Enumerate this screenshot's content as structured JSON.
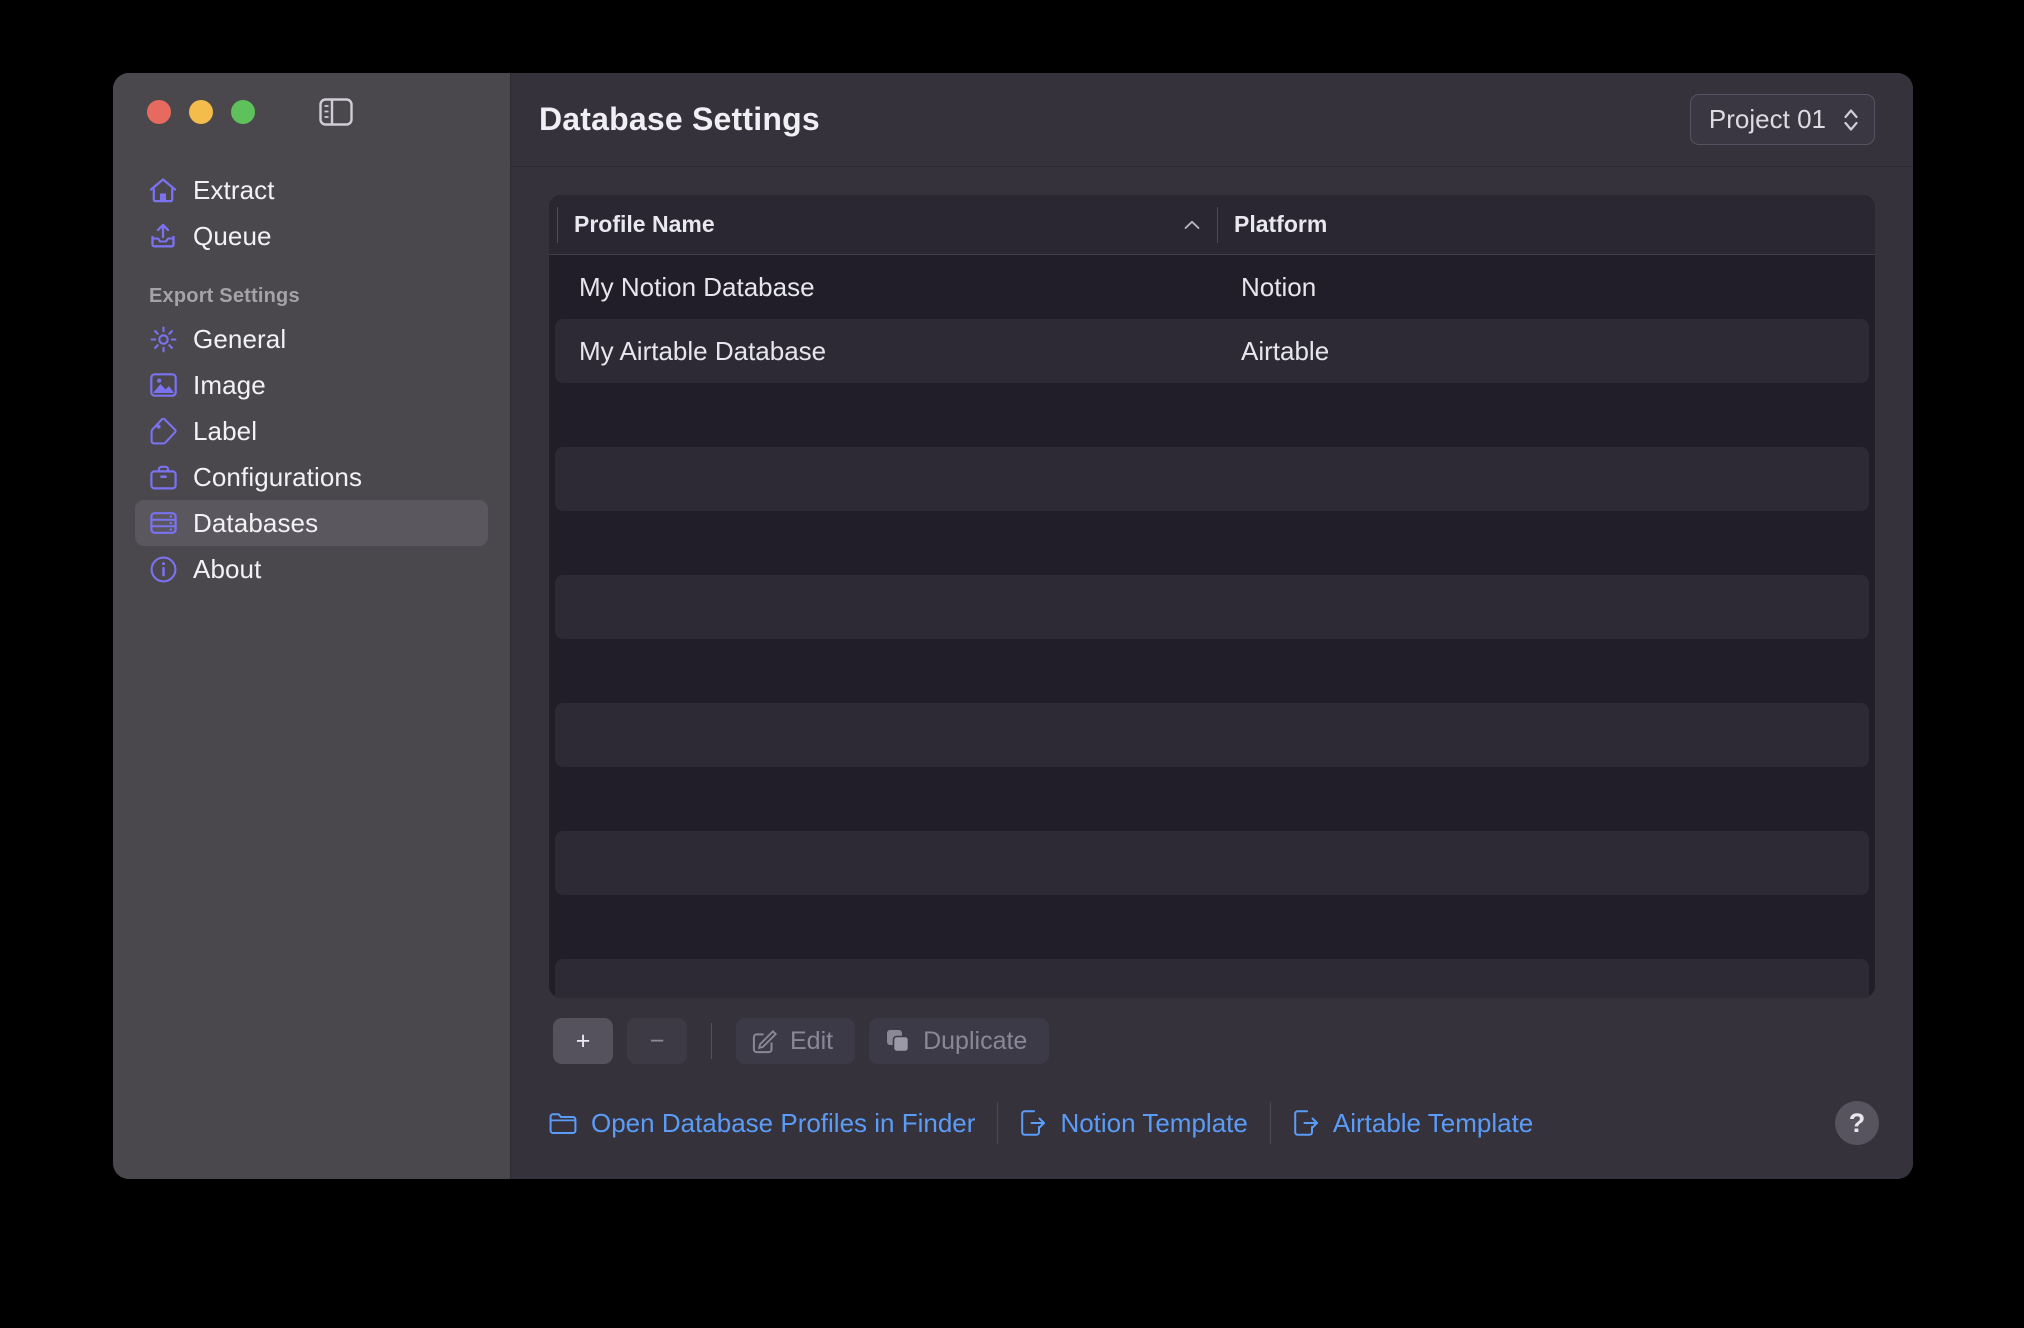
{
  "window": {
    "traffic_lights": [
      {
        "name": "close",
        "color": "#e76a5e"
      },
      {
        "name": "minimize",
        "color": "#f3bc4b"
      },
      {
        "name": "zoom",
        "color": "#5ec15a"
      }
    ],
    "sidebar_toggle_icon": "sidebar-toggle-icon"
  },
  "sidebar": {
    "top_items": [
      {
        "label": "Extract",
        "icon": "house-icon"
      },
      {
        "label": "Queue",
        "icon": "upload-tray-icon"
      }
    ],
    "section_label": "Export Settings",
    "items": [
      {
        "label": "General",
        "icon": "gear-icon",
        "selected": false
      },
      {
        "label": "Image",
        "icon": "image-icon",
        "selected": false
      },
      {
        "label": "Label",
        "icon": "tag-icon",
        "selected": false
      },
      {
        "label": "Configurations",
        "icon": "briefcase-icon",
        "selected": false
      },
      {
        "label": "Databases",
        "icon": "database-icon",
        "selected": true
      },
      {
        "label": "About",
        "icon": "info-circle-icon",
        "selected": false
      }
    ],
    "accent_color": "#7b72f0"
  },
  "header": {
    "title": "Database Settings",
    "project_picker": {
      "value": "Project 01",
      "icon": "chevron-up-down-icon"
    }
  },
  "table": {
    "columns": [
      {
        "key": "profile_name",
        "label": "Profile Name",
        "sort": "ascending",
        "sort_icon": "chevron-up-icon"
      },
      {
        "key": "platform",
        "label": "Platform",
        "sort": "none"
      }
    ],
    "rows": [
      {
        "profile_name": "My Notion Database",
        "platform": "Notion"
      },
      {
        "profile_name": "My Airtable Database",
        "platform": "Airtable"
      }
    ],
    "empty_row_count": 10
  },
  "toolbar": {
    "add_label": "+",
    "remove_label": "−",
    "edit_label": "Edit",
    "duplicate_label": "Duplicate",
    "edit_icon": "pencil-square-icon",
    "duplicate_icon": "copy-icon",
    "edit_enabled": false,
    "duplicate_enabled": false
  },
  "footer": {
    "links": [
      {
        "label": "Open Database Profiles in Finder",
        "icon": "folder-icon"
      },
      {
        "label": "Notion Template",
        "icon": "export-doc-icon"
      },
      {
        "label": "Airtable Template",
        "icon": "export-doc-icon"
      }
    ],
    "help_label": "?",
    "link_color": "#5b9cf8"
  }
}
